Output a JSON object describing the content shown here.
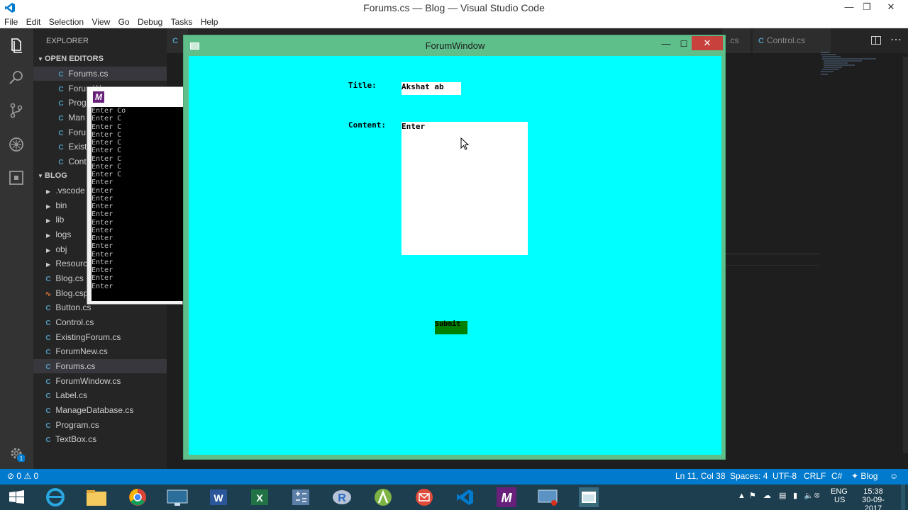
{
  "window": {
    "title": "Forums.cs — Blog — Visual Studio Code"
  },
  "menu": [
    "File",
    "Edit",
    "Selection",
    "View",
    "Go",
    "Debug",
    "Tasks",
    "Help"
  ],
  "sidebar": {
    "header": "EXPLORER",
    "open_editors_label": "OPEN EDITORS",
    "open_editors": [
      "Forums.cs",
      "ForumW",
      "Prog",
      "Man",
      "Foru",
      "Exist",
      "Cont"
    ],
    "blog_label": "BLOG",
    "folders": [
      ".vscode",
      "bin",
      "lib",
      "logs",
      "obj",
      "Resource"
    ],
    "files": [
      "Blog.cs",
      "Blog.csp",
      "Button.cs",
      "Control.cs",
      "ExistingForum.cs",
      "ForumNew.cs",
      "Forums.cs",
      "ForumWindow.cs",
      "Label.cs",
      "ManageDatabase.cs",
      "Program.cs",
      "TextBox.cs"
    ],
    "selected_file": "Forums.cs"
  },
  "tabs": [
    "C",
    ".cs",
    "Control.cs"
  ],
  "console": {
    "lines": [
      "Enter Co",
      "Enter C",
      "Enter C",
      "Enter C",
      "Enter C",
      "Enter C",
      "Enter C",
      "Enter C",
      "Enter C",
      "Enter",
      "Enter",
      "Enter",
      "Enter",
      "Enter",
      "Enter",
      "Enter",
      "Enter",
      "Enter",
      "Enter",
      "Enter",
      "Enter",
      "Enter",
      "Enter"
    ]
  },
  "forum_window": {
    "title": "ForumWindow",
    "title_label": "Title:",
    "title_value": "Akshat ab",
    "content_label": "Content:",
    "content_value": "Enter",
    "submit_label": "Submit"
  },
  "statusbar": {
    "errors": "0",
    "warnings": "0",
    "position": "Ln 11, Col 38",
    "spaces": "Spaces: 4",
    "encoding": "UTF-8",
    "eol": "CRLF",
    "language": "C#",
    "project": "Blog"
  },
  "tray": {
    "lang": "ENG",
    "region": "US",
    "time": "15:38",
    "date": "30-09-2017"
  },
  "colors": {
    "accent": "#007acc",
    "canvas": "#00ffff",
    "window_frame": "#5fbf8b",
    "submit": "#008000"
  }
}
